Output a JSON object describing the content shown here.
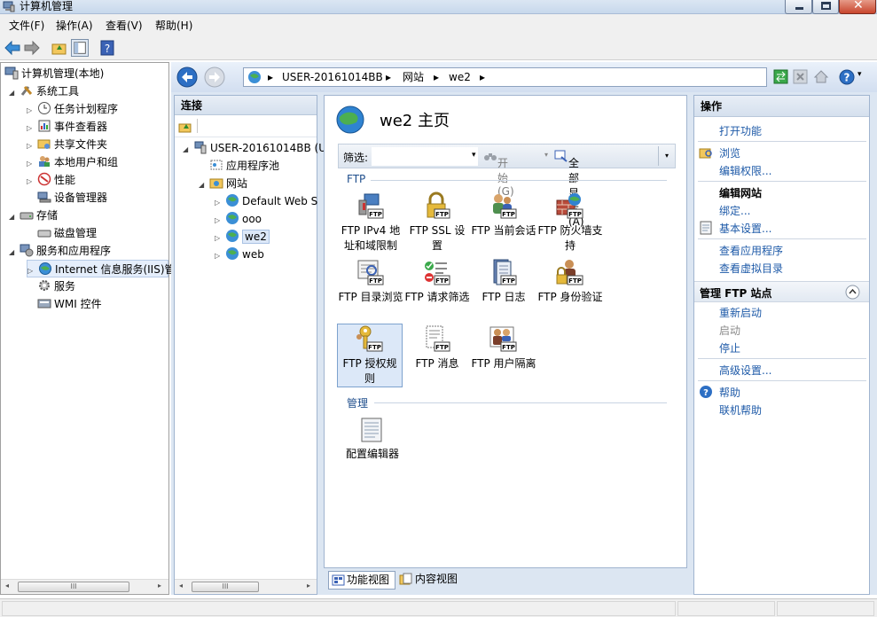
{
  "window": {
    "title": "计算机管理"
  },
  "menu": [
    "文件(F)",
    "操作(A)",
    "查看(V)",
    "帮助(H)"
  ],
  "tree": {
    "root": "计算机管理(本地)",
    "items": [
      {
        "label": "系统工具"
      },
      {
        "label": "任务计划程序"
      },
      {
        "label": "事件查看器"
      },
      {
        "label": "共享文件夹"
      },
      {
        "label": "本地用户和组"
      },
      {
        "label": "性能"
      },
      {
        "label": "设备管理器"
      },
      {
        "label": "存储"
      },
      {
        "label": "磁盘管理"
      },
      {
        "label": "服务和应用程序"
      },
      {
        "label": "Internet 信息服务(IIS)管"
      },
      {
        "label": "服务"
      },
      {
        "label": "WMI 控件"
      }
    ]
  },
  "scroll_thumb": "III",
  "address": {
    "segments": [
      "USER-20161014BB",
      "网站",
      "we2"
    ],
    "separator": "▸"
  },
  "connections": {
    "header": "连接",
    "server": "USER-20161014BB (U",
    "app_pools": "应用程序池",
    "sites": "网站",
    "site_list": [
      "Default Web S",
      "ooo",
      "we2",
      "web"
    ]
  },
  "center": {
    "title": "we2 主页",
    "filter_label": "筛选:",
    "start_button": "开始(G)",
    "show_all_button": "全部显示(A)",
    "groups": [
      {
        "name": "FTP",
        "features": [
          {
            "label": "FTP IPv4 地址和域限制",
            "icon": "ip-restriction-icon"
          },
          {
            "label": "FTP SSL 设置",
            "icon": "ssl-lock-icon"
          },
          {
            "label": "FTP 当前会话",
            "icon": "sessions-icon"
          },
          {
            "label": "FTP 防火墙支持",
            "icon": "firewall-icon"
          },
          {
            "label": "FTP 目录浏览",
            "icon": "directory-browse-icon"
          },
          {
            "label": "FTP 请求筛选",
            "icon": "request-filter-icon"
          },
          {
            "label": "FTP 日志",
            "icon": "log-icon"
          },
          {
            "label": "FTP 身份验证",
            "icon": "auth-icon"
          },
          {
            "label": "FTP 授权规则",
            "icon": "authorization-key-icon"
          },
          {
            "label": "FTP 消息",
            "icon": "message-icon"
          },
          {
            "label": "FTP 用户隔离",
            "icon": "user-isolation-icon"
          }
        ]
      },
      {
        "name": "管理",
        "features": [
          {
            "label": "配置编辑器",
            "icon": "config-editor-icon"
          }
        ]
      }
    ],
    "tabs": {
      "features": "功能视图",
      "content": "内容视图"
    }
  },
  "actions": {
    "header": "操作",
    "open_feature": "打开功能",
    "explore": "浏览",
    "edit_permissions": "编辑权限...",
    "edit_site_heading": "编辑网站",
    "bindings": "绑定...",
    "basic_settings": "基本设置...",
    "view_apps": "查看应用程序",
    "view_vdirs": "查看虚拟目录",
    "manage_ftp_heading": "管理 FTP 站点",
    "restart": "重新启动",
    "start": "启动",
    "stop": "停止",
    "advanced": "高级设置...",
    "help": "帮助",
    "online_help": "联机帮助"
  },
  "colors": {
    "accent": "#1e5aa8",
    "selected": "#dce8f8",
    "frame": "#dce6f2"
  }
}
